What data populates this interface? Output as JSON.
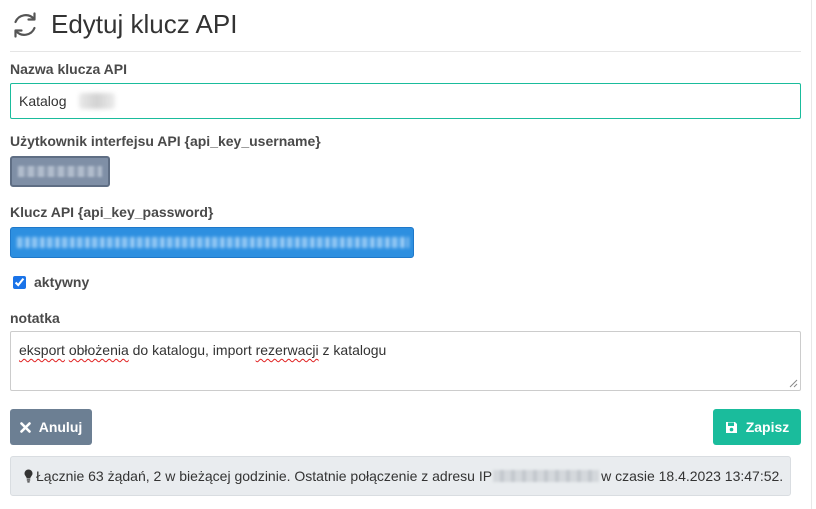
{
  "header": {
    "title": "Edytuj klucz API",
    "icon": "refresh-icon"
  },
  "form": {
    "name_label": "Nazwa klucza API",
    "name_value": "Katalog",
    "username_label": "Użytkownik interfejsu API {api_key_username}",
    "password_label": "Klucz API {api_key_password}",
    "active_label": "aktywny",
    "active_checked": true,
    "note_label": "notatka",
    "note_parts": {
      "p1": "eksport",
      "p2": " ",
      "p3": "obłożenia",
      "p4": " do katalogu, import ",
      "p5": "rezerwacji",
      "p6": " z katalogu"
    }
  },
  "buttons": {
    "cancel_label": "Anuluj",
    "save_label": "Zapisz"
  },
  "info": {
    "prefix": "Łącznie 63 żądań, 2 w bieżącej godzinie. Ostatnie połączenie z adresu IP",
    "suffix": "w czasie 18.4.2023 13:47:52."
  },
  "colors": {
    "accent": "#1abc9c",
    "cancel": "#6c7f93",
    "info_bg": "#e9ecef"
  }
}
